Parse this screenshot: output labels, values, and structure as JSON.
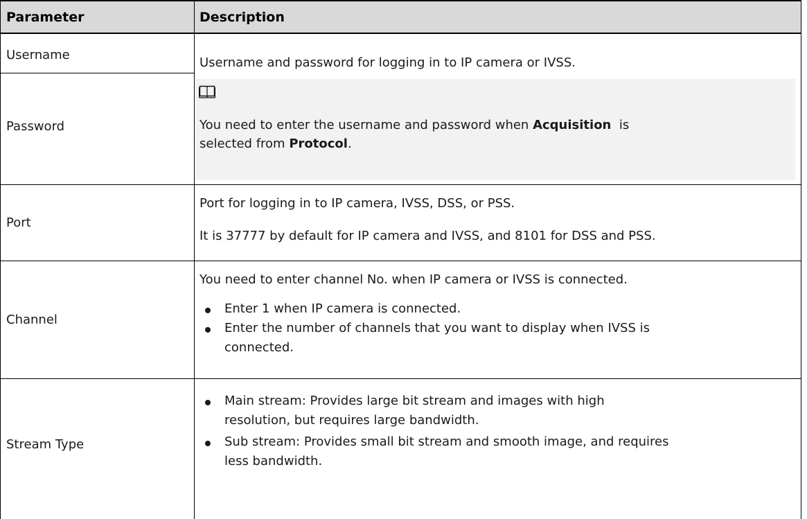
{
  "header": {
    "parameter": "Parameter",
    "description": "Description"
  },
  "rows": {
    "username": {
      "param": "Username",
      "desc": "Username and password for logging in to IP camera or IVSS."
    },
    "password": {
      "param": "Password",
      "note_line1_prefix": "You need to enter the username and password when ",
      "note_bold1": "Acquisition",
      "note_line1_suffix": "  is",
      "note_line2_prefix": "selected from ",
      "note_bold2": "Protocol",
      "note_line2_suffix": ".",
      "note_icon": "book-note-icon"
    },
    "port": {
      "param": "Port",
      "desc1": "Port for logging in to IP camera, IVSS, DSS, or PSS.",
      "desc2": "It is 37777 by default for IP camera and IVSS, and 8101 for DSS and PSS."
    },
    "channel": {
      "param": "Channel",
      "desc": "You need to enter channel No. when IP camera or IVSS is connected.",
      "bullet1": "Enter 1 when IP camera is connected.",
      "bullet2_line1": "Enter the number of channels that you want to display when IVSS is",
      "bullet2_line2": "connected."
    },
    "stream_type": {
      "param": "Stream Type",
      "bullet1_line1": "Main stream: Provides large bit stream and images with high",
      "bullet1_line2": "resolution, but requires large bandwidth.",
      "bullet2_line1": "Sub stream: Provides small bit stream and smooth image, and requires",
      "bullet2_line2": "less bandwidth."
    }
  }
}
